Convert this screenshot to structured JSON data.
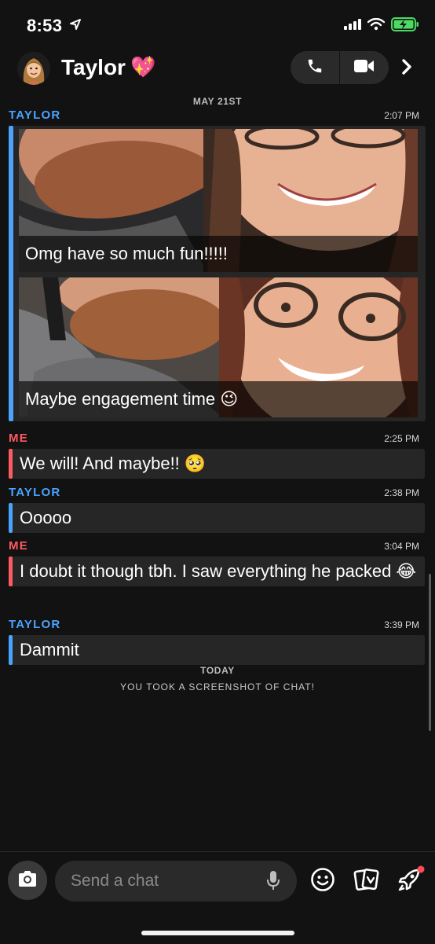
{
  "status_bar": {
    "time": "8:53"
  },
  "header": {
    "contact_name": "Taylor",
    "name_emoji": "💖"
  },
  "chat": {
    "date_separator": "MAY 21ST",
    "snaps": [
      {
        "sender": "TAYLOR",
        "time": "2:07 PM",
        "caption": "Omg have so much fun!!!!!"
      },
      {
        "caption": "Maybe engagement time 😉"
      }
    ],
    "messages": [
      {
        "sender": "ME",
        "time": "2:25 PM",
        "text": "We will! And maybe!! 🥺"
      },
      {
        "sender": "TAYLOR",
        "time": "2:38 PM",
        "text": "Ooooo"
      },
      {
        "sender": "ME",
        "time": "3:04 PM",
        "text": "I doubt it though tbh. I saw everything he packed 😂"
      },
      {
        "sender": "TAYLOR",
        "time": "3:39 PM",
        "text": "Dammit"
      }
    ],
    "today_separator": "TODAY",
    "screenshot_notice": "YOU TOOK A SCREENSHOT OF CHAT!"
  },
  "footer": {
    "input_placeholder": "Send a chat"
  },
  "icons": {
    "status": [
      "location-arrow-icon",
      "signal-icon",
      "wifi-icon",
      "battery-charging-icon"
    ],
    "header": [
      "bitmoji-avatar-icon",
      "phone-icon",
      "video-camera-icon",
      "chevron-right-icon"
    ],
    "footer": [
      "camera-icon",
      "microphone-icon",
      "smiley-icon",
      "cards-icon",
      "rocket-icon"
    ]
  },
  "colors": {
    "taylor": "#4aa3ff",
    "me": "#ff5a62",
    "background": "#121212",
    "bubble": "#262626",
    "battery": "#4cd964"
  }
}
